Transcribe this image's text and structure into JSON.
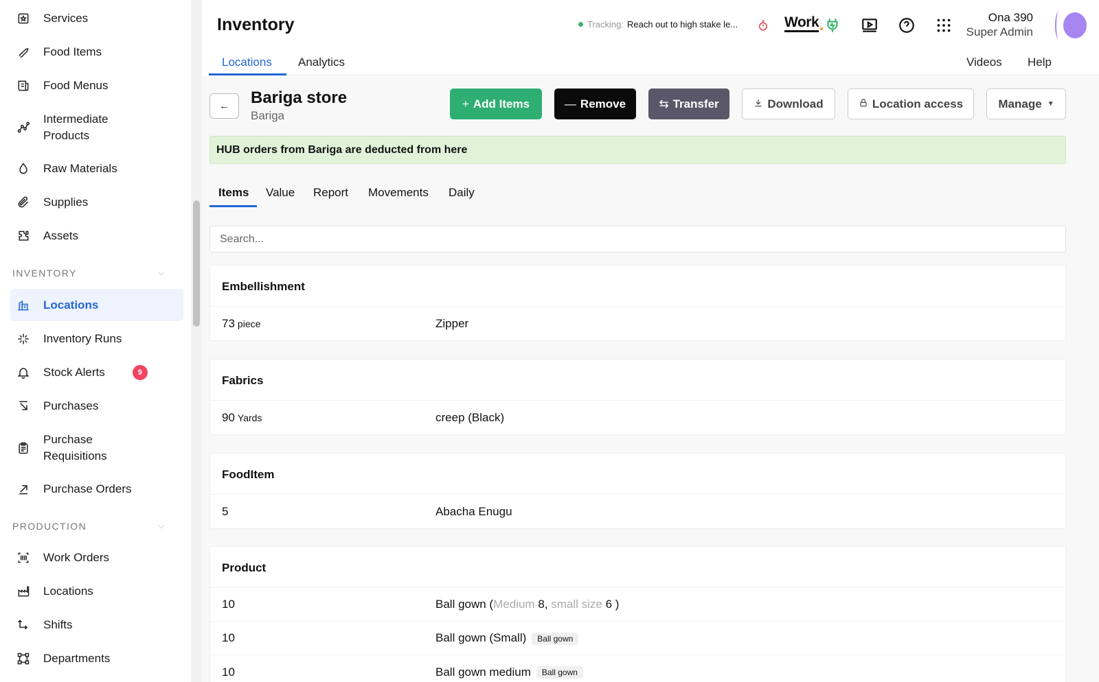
{
  "sidebar": {
    "items_top": [
      {
        "label": "Services",
        "icon": "star-box-icon"
      },
      {
        "label": "Food Items",
        "icon": "rocket-icon"
      },
      {
        "label": "Food Menus",
        "icon": "receipt-icon"
      },
      {
        "label_1": "Intermediate",
        "label_2": "Products",
        "icon": "graph-icon"
      },
      {
        "label": "Raw Materials",
        "icon": "drop-icon"
      },
      {
        "label": "Supplies",
        "icon": "paperclip-icon"
      },
      {
        "label": "Assets",
        "icon": "puzzle-icon"
      }
    ],
    "inventory_section": "INVENTORY",
    "inventory_items": [
      {
        "label": "Locations",
        "icon": "building-icon",
        "active": true
      },
      {
        "label": "Inventory Runs",
        "icon": "sparkle-icon"
      },
      {
        "label": "Stock Alerts",
        "icon": "bell-icon",
        "badge": "9"
      },
      {
        "label": "Purchases",
        "icon": "arrow-down-right-icon"
      },
      {
        "label_1": "Purchase",
        "label_2": "Requisitions",
        "icon": "clipboard-icon"
      },
      {
        "label": "Purchase Orders",
        "icon": "arrow-up-right-icon"
      }
    ],
    "production_section": "PRODUCTION",
    "production_items": [
      {
        "label": "Work Orders",
        "icon": "barcode-icon"
      },
      {
        "label": "Locations",
        "icon": "factory-icon"
      },
      {
        "label": "Shifts",
        "icon": "shift-arrows-icon"
      },
      {
        "label": "Departments",
        "icon": "nodes-icon"
      }
    ]
  },
  "header": {
    "title": "Inventory",
    "tracking_label": "Tracking:",
    "tracking_text": "Reach out to high stake le...",
    "work_logo": "Work",
    "user_name": "Ona 390",
    "user_role": "Super Admin",
    "tabs": [
      "Locations",
      "Analytics"
    ],
    "right_links": [
      "Videos",
      "Help"
    ]
  },
  "store": {
    "name": "Bariga store",
    "subtitle": "Bariga",
    "buttons": {
      "add": "Add Items",
      "remove": "Remove",
      "transfer": "Transfer",
      "download": "Download",
      "access": "Location access",
      "manage": "Manage"
    },
    "notice": "HUB orders from Bariga are deducted from here",
    "tabs": [
      "Items",
      "Value",
      "Report",
      "Movements",
      "Daily"
    ],
    "search_placeholder": "Search..."
  },
  "groups": [
    {
      "name": "Embellishment",
      "rows": [
        {
          "qty": "73",
          "unit": "piece",
          "item": "Zipper"
        }
      ]
    },
    {
      "name": "Fabrics",
      "rows": [
        {
          "qty": "90",
          "unit": "Yards",
          "item": "creep (Black)"
        }
      ]
    },
    {
      "name": "FoodItem",
      "rows": [
        {
          "qty": "5",
          "unit": "",
          "item": "Abacha Enugu"
        }
      ]
    },
    {
      "name": "Product",
      "rows": [
        {
          "qty": "10",
          "item": "Ball gown (",
          "v1_label": "Medium",
          "v1": "8,",
          "v2_label": "small size",
          "v2": "6",
          "close": ")"
        },
        {
          "qty": "10",
          "item": "Ball gown (Small)",
          "tag": "Ball gown"
        },
        {
          "qty": "10",
          "item": "Ball gown medium",
          "tag": "Ball gown"
        }
      ]
    }
  ],
  "colors": {
    "accent": "#2166d6",
    "green": "#2fae73",
    "badge": "#f04460",
    "avatar": "#a786f2"
  }
}
